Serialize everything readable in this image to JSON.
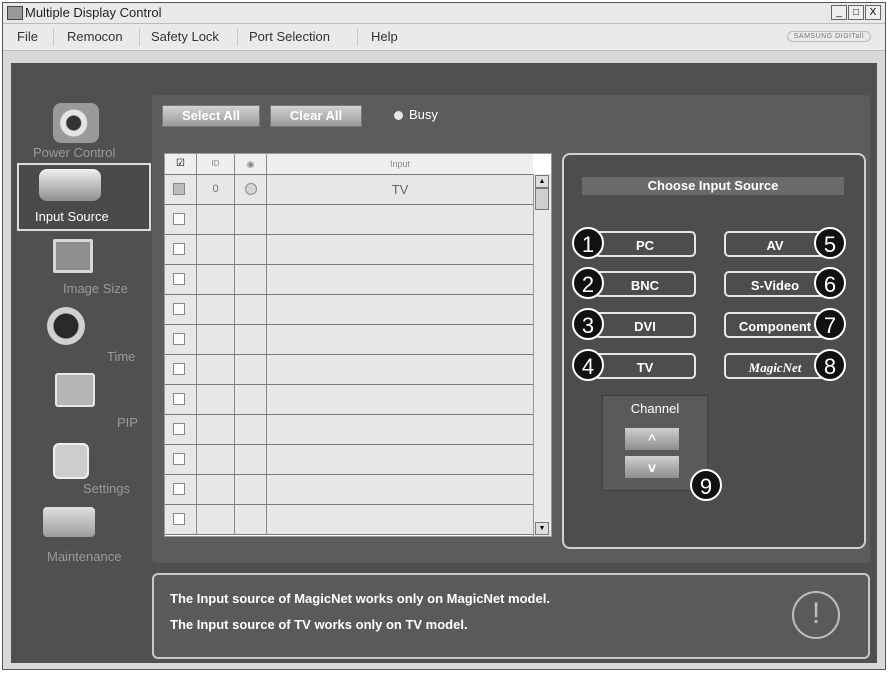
{
  "window": {
    "title": "Multiple Display Control",
    "controls": {
      "minimize": "_",
      "restore": "□",
      "close": "X"
    }
  },
  "menu": {
    "items": [
      "File",
      "Remocon",
      "Safety Lock",
      "Port Selection",
      "Help"
    ],
    "brand": "SAMSUNG DIGITall"
  },
  "sidebar": {
    "items": [
      {
        "label": "Power Control",
        "icon": "power-control-icon"
      },
      {
        "label": "Input Source",
        "icon": "input-source-icon",
        "selected": true
      },
      {
        "label": "Image Size",
        "icon": "image-size-icon"
      },
      {
        "label": "Time",
        "icon": "clock-icon"
      },
      {
        "label": "PIP",
        "icon": "pip-icon"
      },
      {
        "label": "Settings",
        "icon": "settings-icon"
      },
      {
        "label": "Maintenance",
        "icon": "maintenance-icon"
      }
    ]
  },
  "toolbar": {
    "select_all": "Select All",
    "clear_all": "Clear All",
    "busy": "Busy"
  },
  "grid": {
    "columns": [
      "☑",
      "ID",
      "◉",
      "Input"
    ],
    "rows": [
      {
        "checked": true,
        "id": "0",
        "input": "TV"
      },
      {
        "checked": false,
        "id": "",
        "input": ""
      },
      {
        "checked": false,
        "id": "",
        "input": ""
      },
      {
        "checked": false,
        "id": "",
        "input": ""
      },
      {
        "checked": false,
        "id": "",
        "input": ""
      },
      {
        "checked": false,
        "id": "",
        "input": ""
      },
      {
        "checked": false,
        "id": "",
        "input": ""
      },
      {
        "checked": false,
        "id": "",
        "input": ""
      },
      {
        "checked": false,
        "id": "",
        "input": ""
      },
      {
        "checked": false,
        "id": "",
        "input": ""
      },
      {
        "checked": false,
        "id": "",
        "input": ""
      },
      {
        "checked": false,
        "id": "",
        "input": ""
      }
    ]
  },
  "input_source": {
    "title": "Choose Input Source",
    "buttons": [
      {
        "label": "PC",
        "number": "1"
      },
      {
        "label": "BNC",
        "number": "2"
      },
      {
        "label": "DVI",
        "number": "3"
      },
      {
        "label": "TV",
        "number": "4"
      },
      {
        "label": "AV",
        "number": "5"
      },
      {
        "label": "S-Video",
        "number": "6"
      },
      {
        "label": "Component",
        "number": "7"
      },
      {
        "label": "MagicNet",
        "number": "8"
      }
    ],
    "channel": {
      "label": "Channel",
      "up": "^",
      "down": "v",
      "number": "9"
    }
  },
  "footer": {
    "messages": [
      "The Input source of MagicNet works only on MagicNet model.",
      "The Input source of TV works only on TV  model."
    ],
    "warning_icon": "!"
  },
  "colors": {
    "panel": "#505050",
    "button_border": "#e6e6e6",
    "badge": "#111111"
  }
}
